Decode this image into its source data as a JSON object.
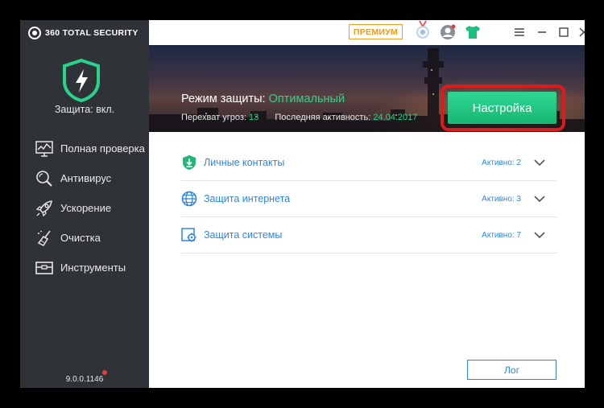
{
  "brand": {
    "name": "360 TOTAL SECURITY"
  },
  "sidebar": {
    "status": "Защита: вкл.",
    "items": [
      {
        "label": "Полная проверка",
        "icon": "chart-monitor-icon"
      },
      {
        "label": "Антивирус",
        "icon": "magnifier-icon"
      },
      {
        "label": "Ускорение",
        "icon": "rocket-icon"
      },
      {
        "label": "Очистка",
        "icon": "broom-icon"
      },
      {
        "label": "Инструменты",
        "icon": "toolbox-icon"
      }
    ],
    "version": "9.0.0.1146"
  },
  "topbar": {
    "premium": "ПРЕМИУМ"
  },
  "banner": {
    "mode_label": "Режим защиты:",
    "mode_value": "Оптимальный",
    "threats_label": "Перехват угроз:",
    "threats_value": "13",
    "last_label": "Последняя активность:",
    "last_value": "24.04.2017",
    "settings_button": "Настройка"
  },
  "rows": [
    {
      "label": "Личные контакты",
      "status_label": "Активно:",
      "status_value": "2",
      "icon": "shield-download-icon"
    },
    {
      "label": "Защита интернета",
      "status_label": "Активно:",
      "status_value": "3",
      "icon": "globe-icon"
    },
    {
      "label": "Защита системы",
      "status_label": "Активно:",
      "status_value": "7",
      "icon": "system-gear-icon"
    }
  ],
  "log_button": "Лог",
  "colors": {
    "sidebar_bg": "#2f3337",
    "accent_green": "#28d48c",
    "link_blue": "#2e86de",
    "highlight_red": "#e01a1a",
    "premium_orange": "#ef9a1a"
  }
}
